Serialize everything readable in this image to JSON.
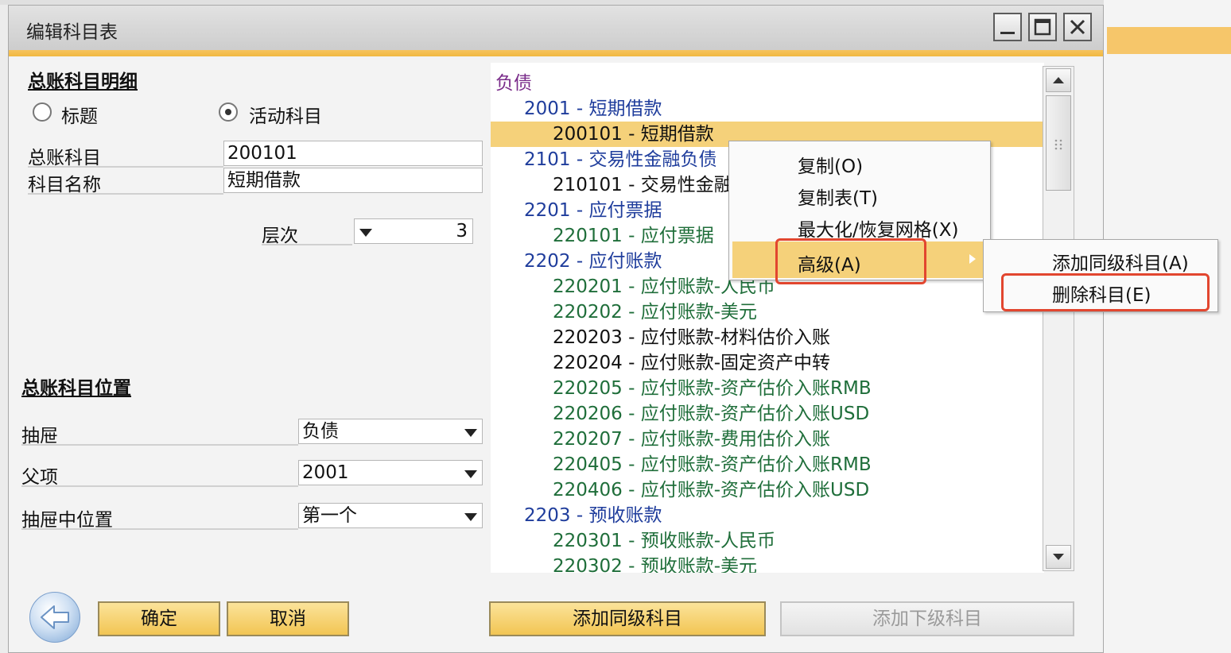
{
  "window": {
    "title": "编辑科目表"
  },
  "details": {
    "section_title": "总账科目明细",
    "radio_title": "标题",
    "radio_active": "活动科目",
    "gl_account_label": "总账科目",
    "gl_account_value": "200101",
    "account_name_label": "科目名称",
    "account_name_value": "短期借款",
    "level_label": "层次",
    "level_value": "3"
  },
  "position": {
    "section_title": "总账科目位置",
    "drawer_label": "抽屉",
    "drawer_value": "负债",
    "parent_label": "父项",
    "parent_value": "2001",
    "drawer_position_label": "抽屉中位置",
    "drawer_position_value": "第一个"
  },
  "tree": {
    "rows": [
      {
        "text": "负债",
        "color": "#7a2c8a",
        "indent": 0,
        "selected": false
      },
      {
        "text": "2001 - 短期借款",
        "color": "#1f3d9c",
        "indent": 1,
        "selected": false
      },
      {
        "text": "200101 - 短期借款",
        "color": "#111111",
        "indent": 2,
        "selected": true
      },
      {
        "text": "2101 - 交易性金融负债",
        "color": "#1f3d9c",
        "indent": 1,
        "selected": false
      },
      {
        "text": "210101 - 交易性金融",
        "color": "#111111",
        "indent": 2,
        "selected": false
      },
      {
        "text": "2201 - 应付票据",
        "color": "#1f3d9c",
        "indent": 1,
        "selected": false
      },
      {
        "text": "220101 - 应付票据",
        "color": "#1f6e3a",
        "indent": 2,
        "selected": false
      },
      {
        "text": "2202 - 应付账款",
        "color": "#1f3d9c",
        "indent": 1,
        "selected": false
      },
      {
        "text": "220201 - 应付账款-人民币",
        "color": "#1f6e3a",
        "indent": 2,
        "selected": false
      },
      {
        "text": "220202 - 应付账款-美元",
        "color": "#1f6e3a",
        "indent": 2,
        "selected": false
      },
      {
        "text": "220203 - 应付账款-材料估价入账",
        "color": "#111111",
        "indent": 2,
        "selected": false
      },
      {
        "text": "220204 - 应付账款-固定资产中转",
        "color": "#111111",
        "indent": 2,
        "selected": false
      },
      {
        "text": "220205 - 应付账款-资产估价入账RMB",
        "color": "#1f6e3a",
        "indent": 2,
        "selected": false
      },
      {
        "text": "220206 - 应付账款-资产估价入账USD",
        "color": "#1f6e3a",
        "indent": 2,
        "selected": false
      },
      {
        "text": "220207 - 应付账款-费用估价入账",
        "color": "#1f6e3a",
        "indent": 2,
        "selected": false
      },
      {
        "text": "220405 - 应付账款-资产估价入账RMB",
        "color": "#1f6e3a",
        "indent": 2,
        "selected": false
      },
      {
        "text": "220406 - 应付账款-资产估价入账USD",
        "color": "#1f6e3a",
        "indent": 2,
        "selected": false
      },
      {
        "text": "2203 - 预收账款",
        "color": "#1f3d9c",
        "indent": 1,
        "selected": false
      },
      {
        "text": "220301 - 预收账款-人民币",
        "color": "#1f6e3a",
        "indent": 2,
        "selected": false
      },
      {
        "text": "220302 - 预收账款-美元",
        "color": "#1f6e3a",
        "indent": 2,
        "selected": false
      }
    ]
  },
  "context_menu": {
    "copy": "复制(O)",
    "copy_table": "复制表(T)",
    "max_restore": "最大化/恢复网格(X)",
    "advanced": "高级(A)"
  },
  "submenu": {
    "add_same_level": "添加同级科目(A)",
    "delete_account": "删除科目(E)"
  },
  "buttons": {
    "ok": "确定",
    "cancel": "取消",
    "add_same_level": "添加同级科目",
    "add_sub_level": "添加下级科目"
  },
  "icons": {
    "back": "back-arrow-icon",
    "minimize": "minimize-icon",
    "maximize": "maximize-icon",
    "close": "close-icon"
  },
  "colors": {
    "accent": "#f2c553",
    "highlight_box": "#e2462f",
    "selection": "#f5d17a"
  }
}
